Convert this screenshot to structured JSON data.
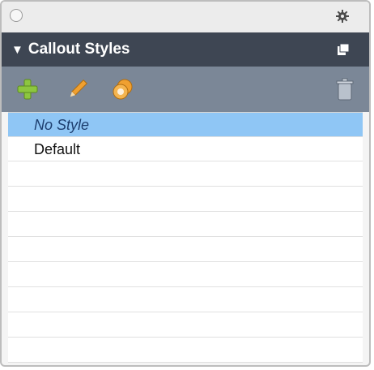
{
  "panel": {
    "title": "Callout Styles",
    "collapse_glyph": "▼"
  },
  "toolbar": {
    "tools": [
      {
        "icon": "plus-icon"
      },
      {
        "icon": "pencil-icon"
      },
      {
        "icon": "duplicate-icon"
      },
      {
        "icon": "trash-icon"
      }
    ]
  },
  "styles_list": {
    "items": [
      {
        "label": "No Style",
        "selected": true
      },
      {
        "label": "Default",
        "selected": false
      }
    ]
  },
  "colors": {
    "header_bg": "#3e4653",
    "toolbar_bg": "#7b8797",
    "selection": "#8fc6f5",
    "plus_green": "#8dc63f",
    "pencil_orange": "#f0a030"
  }
}
